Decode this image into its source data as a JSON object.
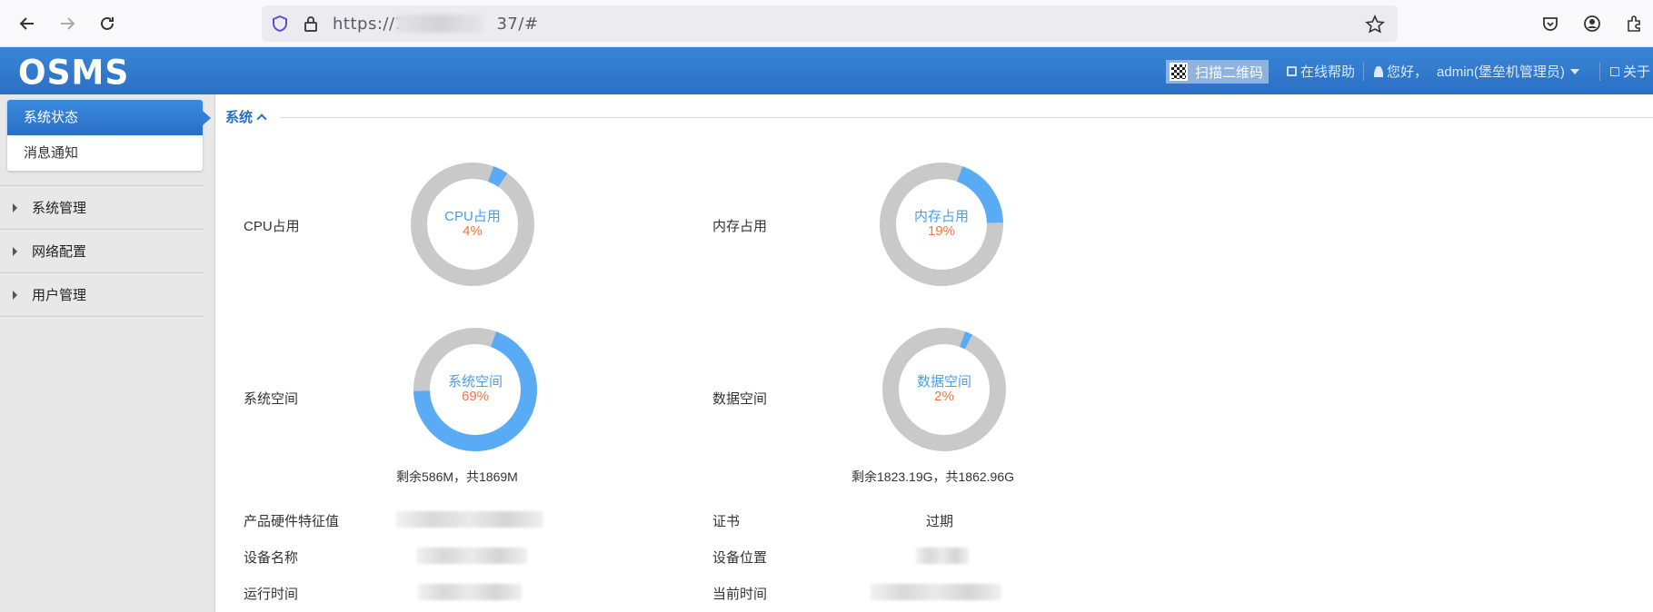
{
  "browser": {
    "url": "https://1",
    "url_tail": "37/#"
  },
  "header": {
    "logo": "OSMS",
    "qr_label": "扫描二维码",
    "help_label": "在线帮助",
    "greeting": "您好，",
    "user": "admin(堡垒机管理员)",
    "about_label": "关于"
  },
  "sidebar": {
    "sub_items": [
      {
        "label": "系统状态",
        "active": true
      },
      {
        "label": "消息通知",
        "active": false
      }
    ],
    "groups": [
      {
        "label": "系统管理"
      },
      {
        "label": "网络配置"
      },
      {
        "label": "用户管理"
      }
    ]
  },
  "main": {
    "section_title": "系统",
    "metrics": [
      {
        "label": "CPU占用",
        "donut_name": "CPU占用",
        "value": "4%",
        "percent": 4
      },
      {
        "label": "内存占用",
        "donut_name": "内存占用",
        "value": "19%",
        "percent": 19
      },
      {
        "label": "系统空间",
        "donut_name": "系统空间",
        "value": "69%",
        "percent": 69,
        "remain": "剩余586M，共1869M"
      },
      {
        "label": "数据空间",
        "donut_name": "数据空间",
        "value": "2%",
        "percent": 2,
        "remain": "剩余1823.19G，共1862.96G"
      }
    ],
    "info": {
      "hw_label": "产品硬件特征值",
      "cert_label": "证书",
      "cert_value": "过期",
      "device_name_label": "设备名称",
      "device_location_label": "设备位置",
      "uptime_label": "运行时间",
      "current_time_label": "当前时间"
    }
  },
  "colors": {
    "accent": "#2a6fc4",
    "donut_fill": "#5aabf5",
    "donut_track": "#c9c9c9",
    "value_orange": "#f0763a"
  }
}
